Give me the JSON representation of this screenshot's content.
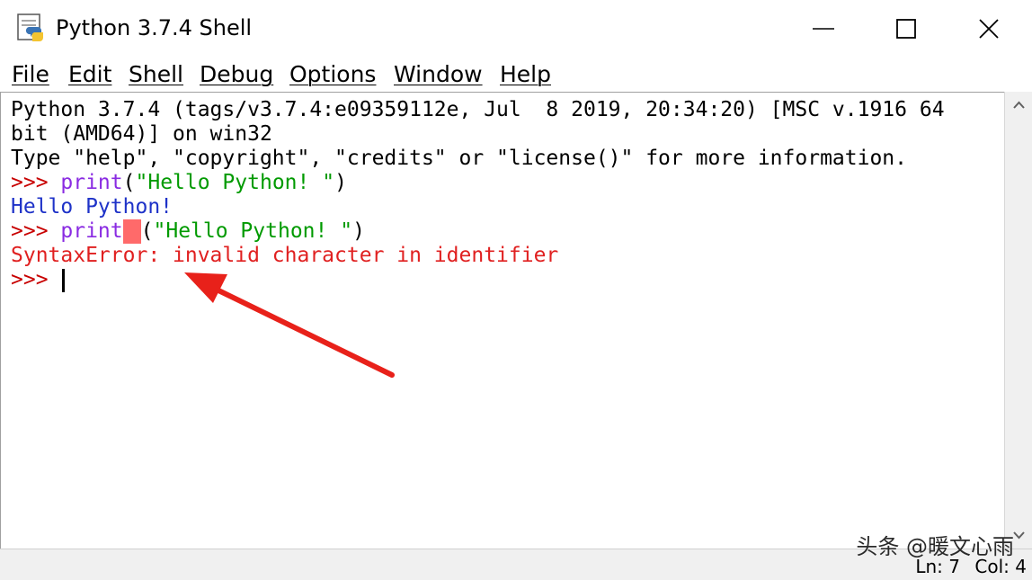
{
  "window": {
    "title": "Python 3.7.4 Shell",
    "icons": {
      "app": "python-idle-icon",
      "minimize": "minimize-icon",
      "maximize": "maximize-icon",
      "close": "close-icon"
    }
  },
  "menu": {
    "items": [
      "File",
      "Edit",
      "Shell",
      "Debug",
      "Options",
      "Window",
      "Help"
    ]
  },
  "shell": {
    "banner1": "Python 3.7.4 (tags/v3.7.4:e09359112e, Jul  8 2019, 20:34:20) [MSC v.1916 64",
    "banner2": "bit (AMD64)] on win32",
    "banner3": "Type \"help\", \"copyright\", \"credits\" or \"license()\" for more information.",
    "prompt": ">>> ",
    "cmd1_kw": "print",
    "cmd1_rest": "(\"Hello Python! \")",
    "output1": "Hello Python!",
    "cmd2_kw": "print",
    "cmd2_rest": "(\"Hello Python! \")",
    "error": "SyntaxError: invalid character in identifier",
    "prompt_final": ">>> "
  },
  "colors": {
    "prompt": "#c80000",
    "keyword": "#8a2be2",
    "string": "#009a00",
    "output": "#1e32c8",
    "error": "#e02020",
    "highlight": "#ff6a6a",
    "annotation_arrow": "#e8211a"
  },
  "status": {
    "ln": "Ln: 7",
    "col": "Col: 4"
  },
  "watermark": "头条 @暖文心雨"
}
